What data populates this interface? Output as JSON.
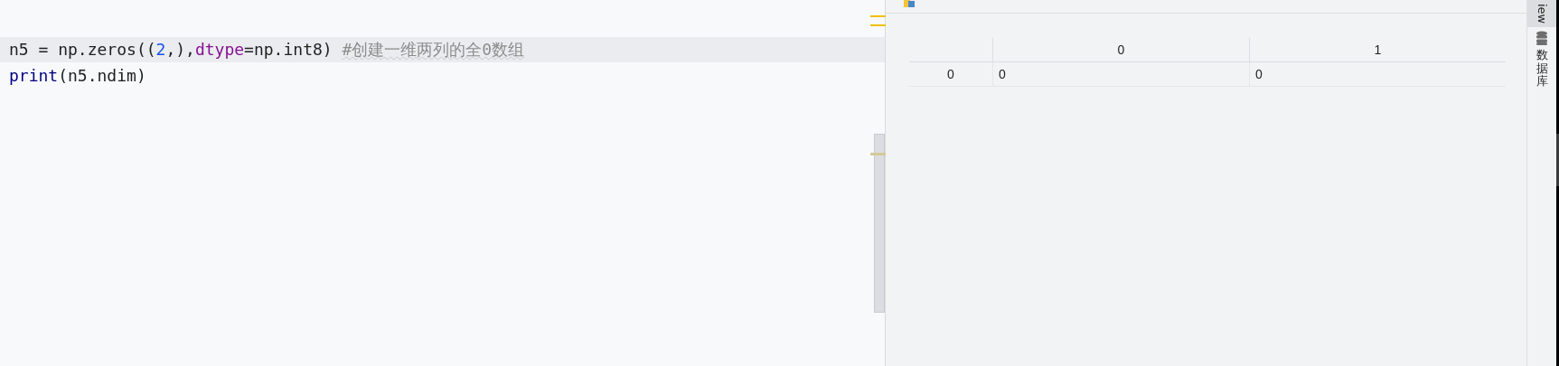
{
  "editor": {
    "lines": [
      {
        "highlighted": true,
        "tokens": [
          {
            "kind": "plain",
            "text": "n5 = np.zeros(("
          },
          {
            "kind": "number",
            "text": "2"
          },
          {
            "kind": "plain",
            "text": ",),"
          },
          {
            "kind": "param",
            "text": "dtype"
          },
          {
            "kind": "plain",
            "text": "=np.int8) "
          },
          {
            "kind": "comment",
            "text": "#创建一维两列的全0数组"
          }
        ]
      },
      {
        "highlighted": false,
        "tokens": [
          {
            "kind": "builtin",
            "text": "print"
          },
          {
            "kind": "plain",
            "text": "(n5.ndim)"
          }
        ]
      }
    ]
  },
  "table": {
    "columns": [
      "0",
      "1"
    ],
    "rows": [
      {
        "index": "0",
        "cells": [
          "0",
          "0"
        ]
      }
    ]
  },
  "side_tabs": [
    {
      "kind": "text",
      "label": "iew",
      "selected": true
    },
    {
      "kind": "database",
      "label": "数据库",
      "selected": false
    }
  ]
}
